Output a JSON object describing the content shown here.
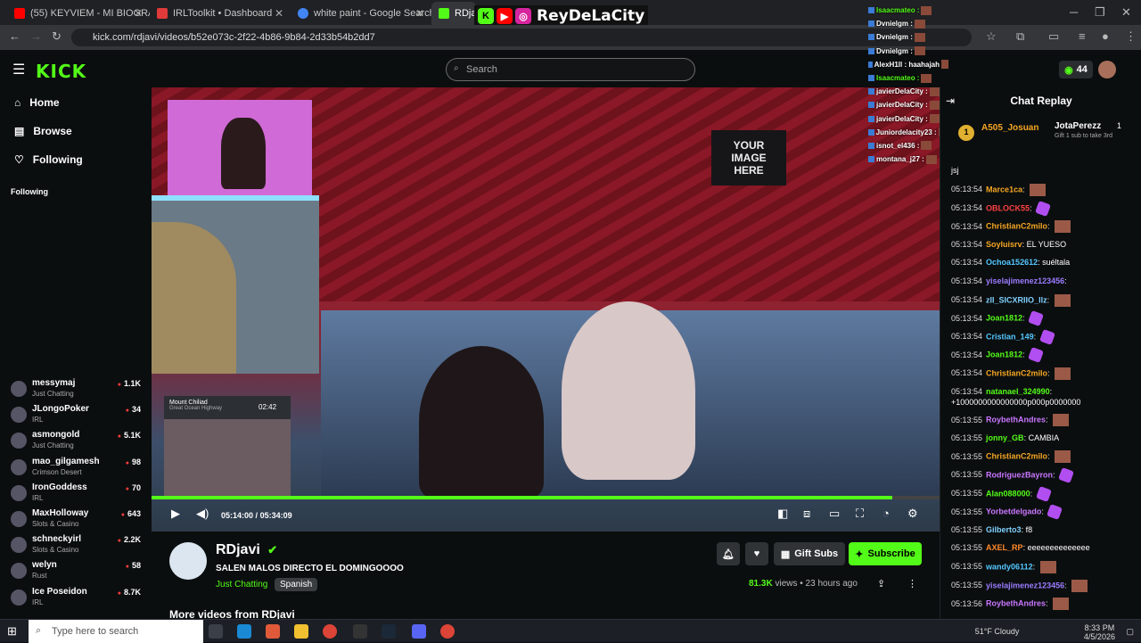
{
  "browser": {
    "tabs": [
      {
        "title": "(55) KEYVIEM - MI BIOGRAFÍA",
        "color": "#ff0000"
      },
      {
        "title": "IRLToolkit • Dashboard",
        "color": "#e03a3a"
      },
      {
        "title": "white paint - Google Search",
        "color": "#4285f4"
      },
      {
        "title": "RDjavi",
        "color": "#53fc18"
      }
    ],
    "url": "kick.com/rdjavi/videos/b52e073c-2f22-4b86-9b84-2d33b54b2dd7"
  },
  "header": {
    "logo": "KICK",
    "search_placeholder": "Search",
    "points": "44"
  },
  "sidebar": {
    "nav": [
      {
        "label": "Home",
        "icon": "home-icon"
      },
      {
        "label": "Browse",
        "icon": "browse-icon"
      },
      {
        "label": "Following",
        "icon": "heart-icon"
      }
    ],
    "following_heading": "Following",
    "channels": [
      {
        "name": "messymaj",
        "category": "Just Chatting",
        "viewers": "1.1K"
      },
      {
        "name": "JLongoPoker",
        "category": "IRL",
        "viewers": "34"
      },
      {
        "name": "asmongold",
        "category": "Just Chatting",
        "viewers": "5.1K"
      },
      {
        "name": "mao_gilgamesh",
        "category": "Crimson Desert",
        "viewers": "98"
      },
      {
        "name": "IronGoddess",
        "category": "IRL",
        "viewers": "70"
      },
      {
        "name": "MaxHolloway",
        "category": "Slots & Casino",
        "viewers": "643"
      },
      {
        "name": "schneckyirl",
        "category": "Slots & Casino",
        "viewers": "2.2K"
      },
      {
        "name": "welyn",
        "category": "Rust",
        "viewers": "58"
      },
      {
        "name": "Ice Poseidon",
        "category": "IRL",
        "viewers": "8.7K"
      }
    ]
  },
  "video": {
    "current_time": "05:14:00",
    "duration": "05:34:09",
    "progress": 0.94,
    "sign_text": "YOUR IMAGE HERE",
    "map_location": "Mount Chiliad",
    "map_sublocation": "Great Ocean Highway",
    "map_time": "02:42"
  },
  "overlay": {
    "brand": "ReyDeLaCity",
    "messages": [
      {
        "user": "Isaacmateo :",
        "color": "#53fc18"
      },
      {
        "user": "Dvnielgm :",
        "color": "#ffffff"
      },
      {
        "user": "Dvnielgm :",
        "color": "#ffffff"
      },
      {
        "user": "Dvnielgm :",
        "color": "#ffffff"
      },
      {
        "user": "AlexH1ll : haahajah",
        "color": "#ffffff"
      },
      {
        "user": "Isaacmateo :",
        "color": "#53fc18"
      },
      {
        "user": "javierDelaCity :",
        "color": "#ffffff"
      },
      {
        "user": "javierDelaCity :",
        "color": "#ffffff"
      },
      {
        "user": "javierDelaCity :",
        "color": "#ffffff"
      },
      {
        "user": "Juniordelacity23 :",
        "color": "#ffffff"
      },
      {
        "user": "isnot_el436 :",
        "color": "#ffffff"
      },
      {
        "user": "montana_j27 :",
        "color": "#ffffff"
      }
    ]
  },
  "channel": {
    "name": "RDjavi",
    "title": "SALEN MALOS  DIRECTO EL DOMINGOOOO",
    "category": "Just Chatting",
    "language": "Spanish",
    "views": "81.3K",
    "views_label": "views",
    "age": "23 hours ago",
    "gift_label": "Gift Subs",
    "subscribe_label": "Subscribe",
    "more_videos": "More videos from RDjavi"
  },
  "chat": {
    "title": "Chat Replay",
    "pinned_user": "A505_Josuan",
    "pinned_rank": "1",
    "gifter": "JotaPerezz",
    "gifter_count": "1",
    "gifter_note": "Gift 1 sub to take 3rd",
    "top_message": "jsj",
    "messages": [
      {
        "time": "05:13:54",
        "user": "Marce1ca",
        "color": "#f5a623",
        "text": "",
        "emote": "face"
      },
      {
        "time": "05:13:54",
        "user": "OBLOCK55",
        "color": "#ff4040",
        "text": "",
        "emote": "purple"
      },
      {
        "time": "05:13:54",
        "user": "ChristianC2milo",
        "color": "#f5a623",
        "text": "",
        "emote": "face"
      },
      {
        "time": "05:13:54",
        "user": "Soyluisrv",
        "color": "#f5a623",
        "text": "EL YUESO",
        "emote": ""
      },
      {
        "time": "05:13:54",
        "user": "Ochoa152612",
        "color": "#53c8ff",
        "text": "suéltala",
        "emote": ""
      },
      {
        "time": "05:13:54",
        "user": "yiselajimenez123456",
        "color": "#9b7bff",
        "text": "",
        "emote": ""
      },
      {
        "time": "05:13:54",
        "user": "zll_SICXRIIO_llz",
        "color": "#7fd1ff",
        "text": "",
        "emote": "face"
      },
      {
        "time": "05:13:54",
        "user": "Joan1812",
        "color": "#53fc18",
        "text": "",
        "emote": "purple"
      },
      {
        "time": "05:13:54",
        "user": "Cristian_149",
        "color": "#53c8ff",
        "text": "",
        "emote": "purple"
      },
      {
        "time": "05:13:54",
        "user": "Joan1812",
        "color": "#53fc18",
        "text": "",
        "emote": "purple"
      },
      {
        "time": "05:13:54",
        "user": "ChristianC2milo",
        "color": "#f5a623",
        "text": "",
        "emote": "face"
      },
      {
        "time": "05:13:54",
        "user": "natanael_324990",
        "color": "#53fc18",
        "text": "+1000000000000000p000p0000000",
        "emote": ""
      },
      {
        "time": "05:13:55",
        "user": "RoybethAndres",
        "color": "#c977ff",
        "text": "",
        "emote": "face"
      },
      {
        "time": "05:13:55",
        "user": "jonny_GB",
        "color": "#53fc18",
        "text": "CAMBIA",
        "emote": ""
      },
      {
        "time": "05:13:55",
        "user": "ChristianC2milo",
        "color": "#f5a623",
        "text": "",
        "emote": "face"
      },
      {
        "time": "05:13:55",
        "user": "RodriguezBayron",
        "color": "#c977ff",
        "text": "",
        "emote": "purple"
      },
      {
        "time": "05:13:55",
        "user": "Alan088000",
        "color": "#53fc18",
        "text": "",
        "emote": "purple"
      },
      {
        "time": "05:13:55",
        "user": "Yorbetdelgado",
        "color": "#c977ff",
        "text": "",
        "emote": "purple"
      },
      {
        "time": "05:13:55",
        "user": "Gilberto3",
        "color": "#7fd1ff",
        "text": "f8",
        "emote": ""
      },
      {
        "time": "05:13:55",
        "user": "AXEL_RP",
        "color": "#ff8a2a",
        "text": "eeeeeeeeeeeeee",
        "emote": ""
      },
      {
        "time": "05:13:55",
        "user": "wandy06112",
        "color": "#53c8ff",
        "text": "",
        "emote": "face"
      },
      {
        "time": "05:13:55",
        "user": "yiselajimenez123456",
        "color": "#9b7bff",
        "text": "",
        "emote": "face"
      },
      {
        "time": "05:13:56",
        "user": "RoybethAndres",
        "color": "#c977ff",
        "text": "",
        "emote": "face"
      }
    ]
  },
  "taskbar": {
    "search_placeholder": "Type here to search",
    "weather": "51°F  Cloudy",
    "time": "8:33 PM",
    "date": "4/5/2026"
  }
}
